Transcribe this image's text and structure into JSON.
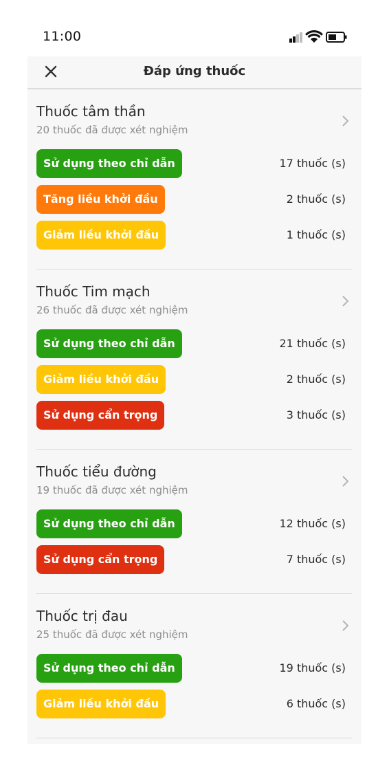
{
  "status_bar": {
    "time": "11:00"
  },
  "header": {
    "title": "Đáp ứng thuốc"
  },
  "colors": {
    "green": "#27a012",
    "orange": "#ff7a0b",
    "yellow": "#ffc607",
    "red": "#df3012"
  },
  "groups": [
    {
      "title": "Thuốc tâm thần",
      "subtitle": "20 thuốc đã được xét nghiệm",
      "rows": [
        {
          "label": "Sử dụng theo chỉ dẫn",
          "count": "17 thuốc (s)",
          "color": "green"
        },
        {
          "label": "Tăng liều khởi đầu",
          "count": "2 thuốc (s)",
          "color": "orange"
        },
        {
          "label": "Giảm liều khởi đầu",
          "count": "1 thuốc (s)",
          "color": "yellow"
        }
      ]
    },
    {
      "title": "Thuốc Tim mạch",
      "subtitle": "26 thuốc đã được xét nghiệm",
      "rows": [
        {
          "label": "Sử dụng theo chỉ dẫn",
          "count": "21 thuốc (s)",
          "color": "green"
        },
        {
          "label": "Giảm liều khởi đầu",
          "count": "2 thuốc (s)",
          "color": "yellow"
        },
        {
          "label": "Sử dụng cẩn trọng",
          "count": "3 thuốc (s)",
          "color": "red"
        }
      ]
    },
    {
      "title": "Thuốc tiểu đường",
      "subtitle": "19 thuốc đã được xét nghiệm",
      "rows": [
        {
          "label": "Sử dụng theo chỉ dẫn",
          "count": "12 thuốc (s)",
          "color": "green"
        },
        {
          "label": "Sử dụng cẩn trọng",
          "count": "7 thuốc (s)",
          "color": "red"
        }
      ]
    },
    {
      "title": "Thuốc trị đau",
      "subtitle": "25 thuốc đã được xét nghiệm",
      "rows": [
        {
          "label": "Sử dụng theo chỉ dẫn",
          "count": "19 thuốc (s)",
          "color": "green"
        },
        {
          "label": "Giảm liều khởi đầu",
          "count": "6 thuốc (s)",
          "color": "yellow"
        }
      ]
    }
  ]
}
